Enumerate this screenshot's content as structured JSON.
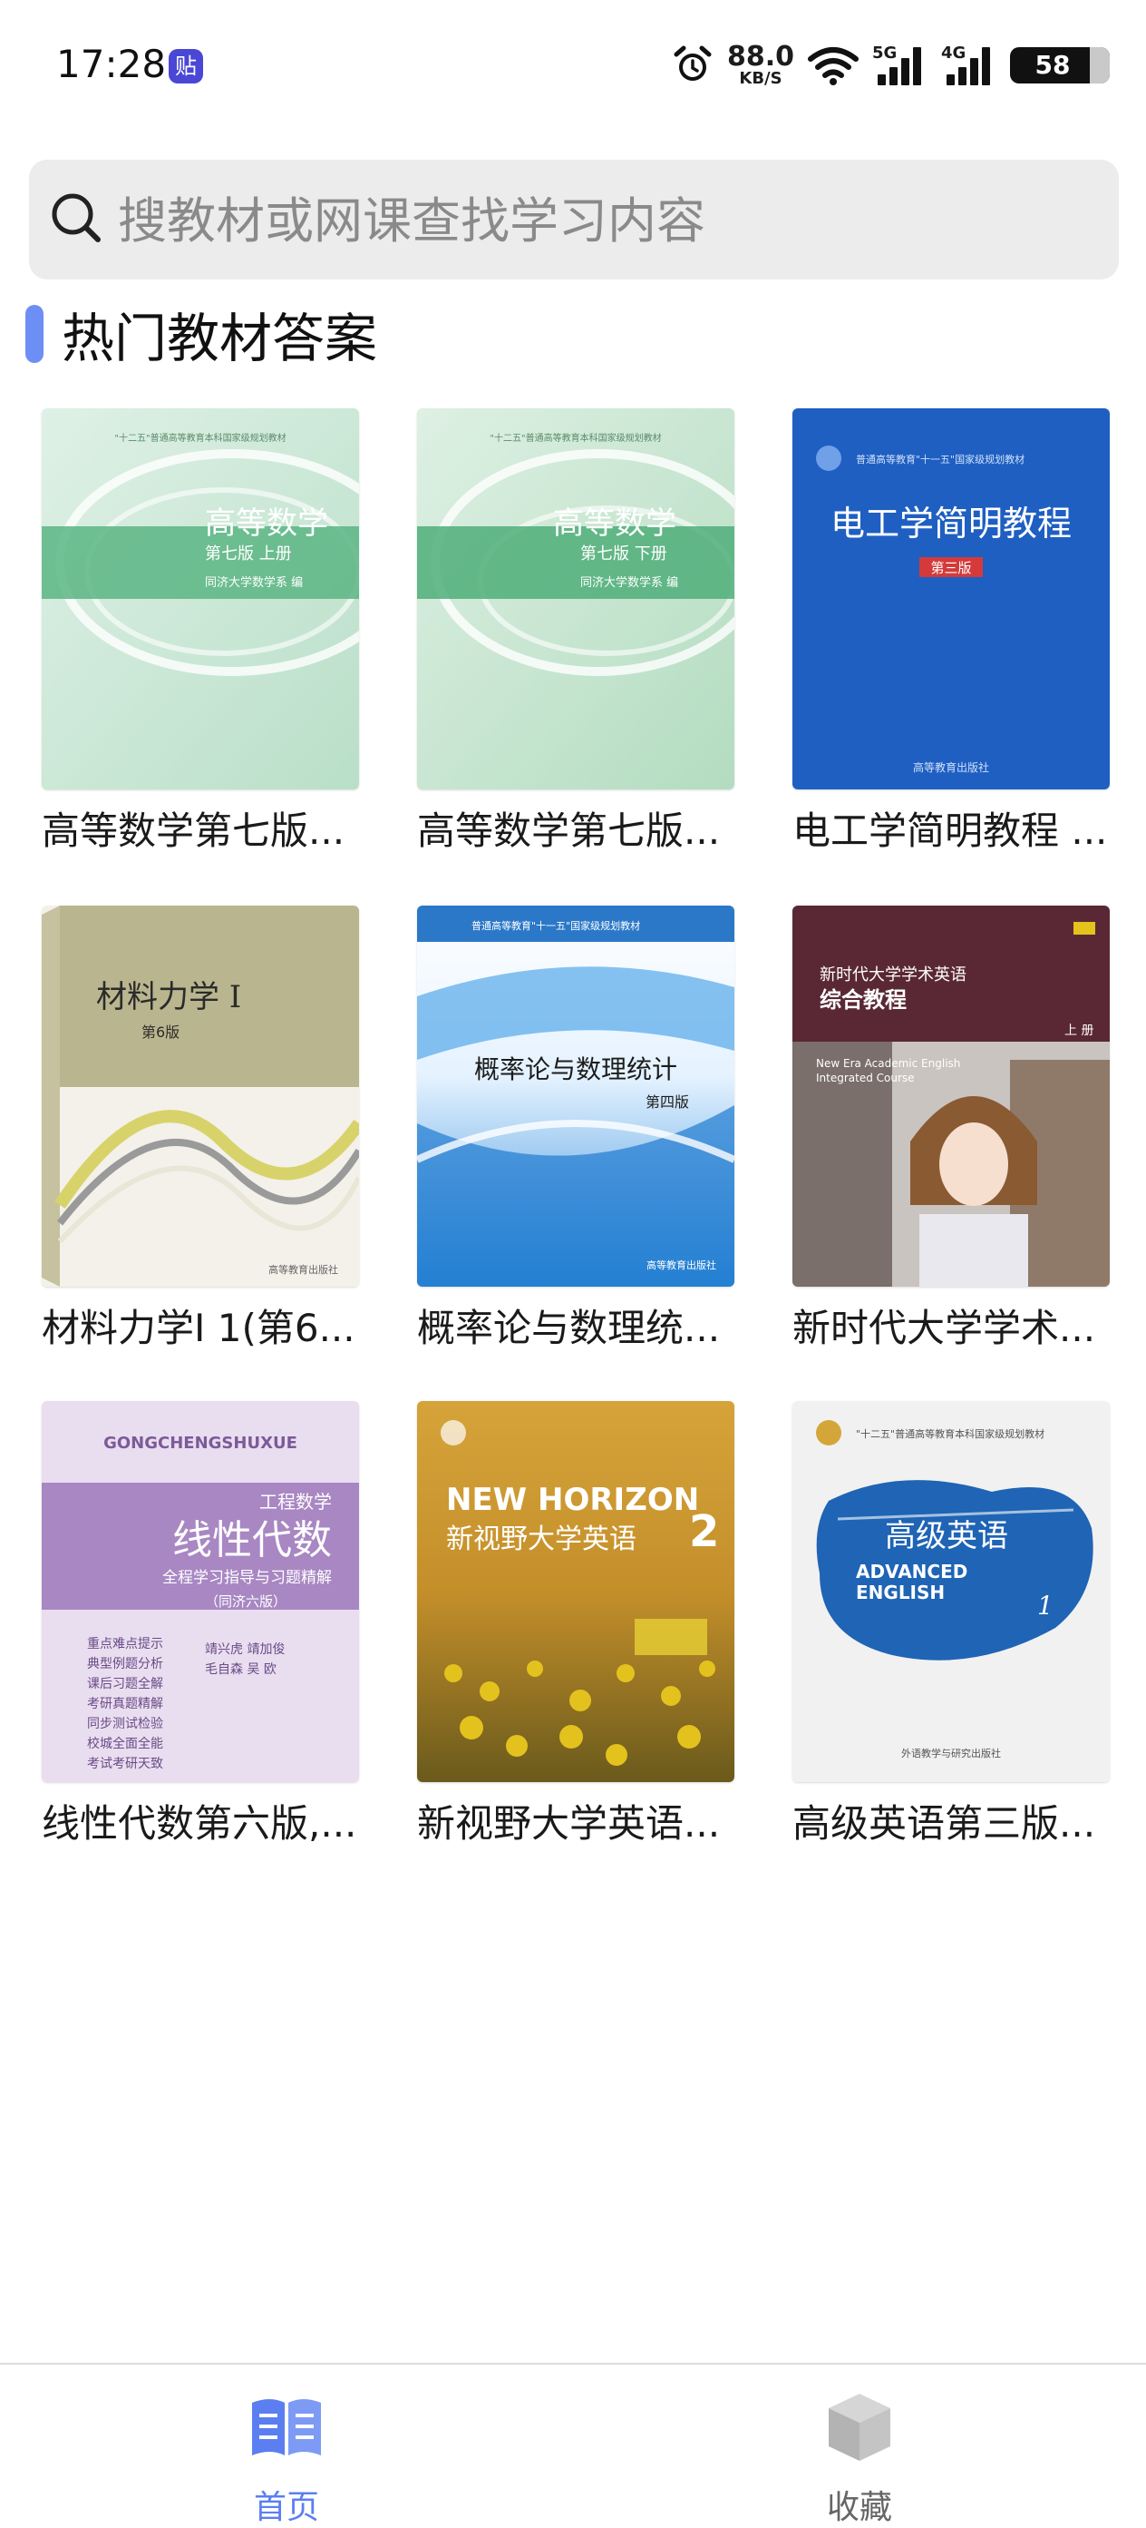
{
  "status_bar": {
    "time": "17:28",
    "notification_badge": "贴",
    "net_speed_value": "88.0",
    "net_speed_unit": "KB/S",
    "signal1_label": "5G",
    "signal2_label": "4G",
    "battery_level": "58"
  },
  "search": {
    "placeholder": "搜教材或网课查找学习内容"
  },
  "section": {
    "title": "热门教材答案"
  },
  "books": [
    {
      "title": "高等数学第七版...",
      "cover_lines": [
        "高等数学",
        "第七版 上册"
      ],
      "cover_footer": "同济大学数学系 编"
    },
    {
      "title": "高等数学第七版...",
      "cover_lines": [
        "高等数学",
        "第七版 下册"
      ],
      "cover_footer": "同济大学数学系 编"
    },
    {
      "title": "电工学简明教程 ...",
      "cover_lines": [
        "电工学简明教程",
        "第三版"
      ],
      "cover_footer": ""
    },
    {
      "title": "材料力学I 1(第6...",
      "cover_lines": [
        "材料力学 I",
        "第6版"
      ],
      "cover_footer": ""
    },
    {
      "title": "概率论与数理统...",
      "cover_lines": [
        "概率论与数理统计",
        "第四版"
      ],
      "cover_footer": "高等教育出版社"
    },
    {
      "title": "新时代大学学术...",
      "cover_lines": [
        "新时代大学学术英语",
        "综合教程",
        "New Era Academic English",
        "Integrated Course"
      ],
      "cover_footer": "上 册"
    },
    {
      "title": "线性代数第六版,...",
      "cover_lines": [
        "GONGCHENGSHUXUE",
        "工程数学",
        "线性代数",
        "全程学习指导与习题精解",
        "（同济六版）"
      ],
      "cover_footer": ""
    },
    {
      "title": "新视野大学英语...",
      "cover_lines": [
        "NEW HORIZON",
        "新视野大学英语",
        "2"
      ],
      "cover_footer": ""
    },
    {
      "title": "高级英语第三版...",
      "cover_lines": [
        "高级英语",
        "ADVANCED",
        "ENGLISH",
        "1"
      ],
      "cover_footer": ""
    }
  ],
  "nav": {
    "home_label": "首页",
    "favorites_label": "收藏"
  },
  "colors": {
    "accent": "#5b7ff0",
    "search_bg": "#ececec"
  }
}
